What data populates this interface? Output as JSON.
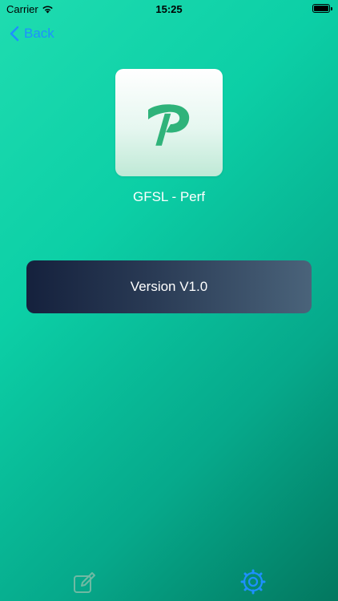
{
  "status_bar": {
    "carrier": "Carrier",
    "time": "15:25",
    "battery_level": 1.0
  },
  "nav": {
    "back_label": "Back"
  },
  "app": {
    "name": "GFSL - Perf",
    "version_text": "Version V1.0"
  },
  "tab_bar": {
    "tabs": [
      {
        "icon": "edit-icon",
        "selected": false
      },
      {
        "icon": "gear-icon",
        "selected": true
      }
    ]
  },
  "colors": {
    "accent": "#1e90ff",
    "logo_green": "#2fb37a"
  }
}
